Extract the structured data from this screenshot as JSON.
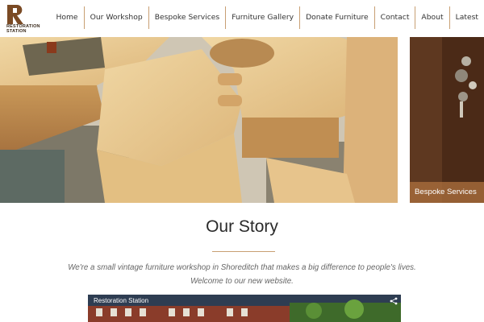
{
  "brand": {
    "name_line1": "RESTORATION",
    "name_line2": "STATION"
  },
  "nav": [
    {
      "label": "Home"
    },
    {
      "label": "Our Workshop"
    },
    {
      "label": "Bespoke Services"
    },
    {
      "label": "Furniture Gallery"
    },
    {
      "label": "Donate Furniture"
    },
    {
      "label": "Contact"
    },
    {
      "label": "About"
    },
    {
      "label": "Latest"
    }
  ],
  "side_panel": {
    "label": "Bespoke Services"
  },
  "story": {
    "title": "Our Story",
    "line1": "We're a small vintage furniture workshop in Shoreditch that makes a big difference to people's lives.",
    "line2": "Welcome to our new website."
  },
  "video": {
    "title": "Restoration Station",
    "share_icon": "share-icon"
  },
  "colors": {
    "accent": "#c89f73",
    "logo_brown": "#7a4a24",
    "text": "#333333"
  }
}
